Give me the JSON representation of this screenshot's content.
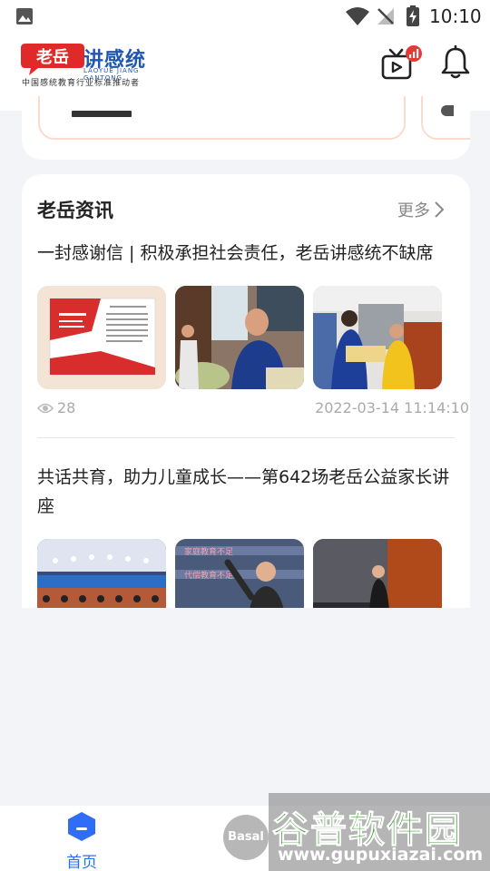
{
  "status_bar": {
    "time": "10:10"
  },
  "header": {
    "logo_red": "老岳",
    "logo_blue": "讲感统",
    "logo_en": "LAOYUE JIANG GANTONG",
    "logo_slogan": "中国感统教育行业标准推动者"
  },
  "news": {
    "section_title": "老岳资讯",
    "more_label": "更多",
    "articles": [
      {
        "title": "一封感谢信 | 积极承担社会责任，老岳讲感统不缺席",
        "views": "28",
        "date": "2022-03-14 11:14:10"
      },
      {
        "title": "共话共育，助力儿童成长——第642场老岳公益家长讲座"
      }
    ]
  },
  "bottom_nav": {
    "home_label": "首页",
    "center_label": "Basal"
  },
  "watermark": {
    "cn": "谷普软件园",
    "url": "www.gupuxiazai.com"
  },
  "colors": {
    "accent": "#2f6df6",
    "logo_red": "#e02a2a",
    "logo_blue": "#1e56b0",
    "meta_gray": "#aaaaaa"
  }
}
